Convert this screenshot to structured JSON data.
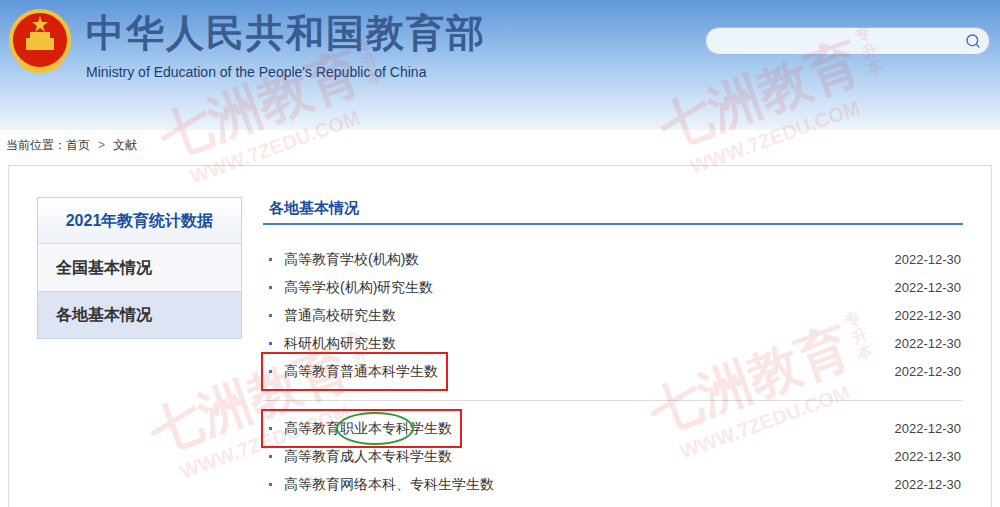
{
  "header": {
    "title": "中华人民共和国教育部",
    "subtitle": "Ministry of Education of the People's Republic of China",
    "search": {
      "placeholder": ""
    }
  },
  "breadcrumb": {
    "label": "当前位置：",
    "items": [
      "首页",
      "文献"
    ],
    "separator": ">"
  },
  "sidebar": {
    "title": "2021年教育统计数据",
    "items": [
      {
        "label": "全国基本情况",
        "selected": false
      },
      {
        "label": "各地基本情况",
        "selected": true
      }
    ]
  },
  "section": {
    "title": "各地基本情况",
    "groups": [
      [
        {
          "label": "高等教育学校(机构)数",
          "date": "2022-12-30",
          "boxed": false,
          "circled": ""
        },
        {
          "label": "高等学校(机构)研究生数",
          "date": "2022-12-30",
          "boxed": false,
          "circled": ""
        },
        {
          "label": "普通高校研究生数",
          "date": "2022-12-30",
          "boxed": false,
          "circled": ""
        },
        {
          "label": "科研机构研究生数",
          "date": "2022-12-30",
          "boxed": false,
          "circled": ""
        },
        {
          "label": "高等教育普通本科学生数",
          "date": "2022-12-30",
          "boxed": true,
          "circled": ""
        }
      ],
      [
        {
          "label": "高等教育职业本专科学生数",
          "date": "2022-12-30",
          "boxed": true,
          "circled": "职业本专科"
        },
        {
          "label": "高等教育成人本专科学生数",
          "date": "2022-12-30",
          "boxed": false,
          "circled": ""
        },
        {
          "label": "高等教育网络本科、专科生学生数",
          "date": "2022-12-30",
          "boxed": false,
          "circled": ""
        }
      ]
    ]
  },
  "watermark": {
    "brand": "七洲教育",
    "url": "WWW.7ZEDU.COM",
    "tag": "专升本"
  }
}
